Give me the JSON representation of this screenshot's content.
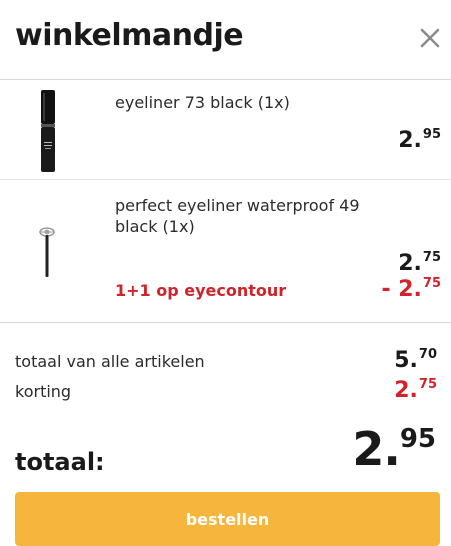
{
  "header": {
    "title": "winkelmandje",
    "close_icon": "close-icon"
  },
  "items": [
    {
      "name": "eyeliner 73 black (1x)",
      "price_main": "2.",
      "price_cents": "95",
      "thumbnail_icon": "eyeliner-pencil-icon"
    },
    {
      "name": "perfect eyeliner waterproof 49 black (1x)",
      "price_main": "2.",
      "price_cents": "75",
      "promo": "1+1 op eyecontour",
      "discount_main": "- 2.",
      "discount_cents": "75",
      "thumbnail_icon": "eyeliner-brush-icon"
    }
  ],
  "summary": {
    "subtotal_label": "totaal van alle artikelen",
    "subtotal_main": "5.",
    "subtotal_cents": "70",
    "discount_label": "korting",
    "discount_main": "2.",
    "discount_cents": "75",
    "total_label": "totaal:",
    "total_main": "2.",
    "total_cents": "95"
  },
  "order_button": {
    "label": "bestellen"
  },
  "colors": {
    "accent": "#f6b53c",
    "discount_red": "#d0232b",
    "text": "#1a1a1a"
  }
}
